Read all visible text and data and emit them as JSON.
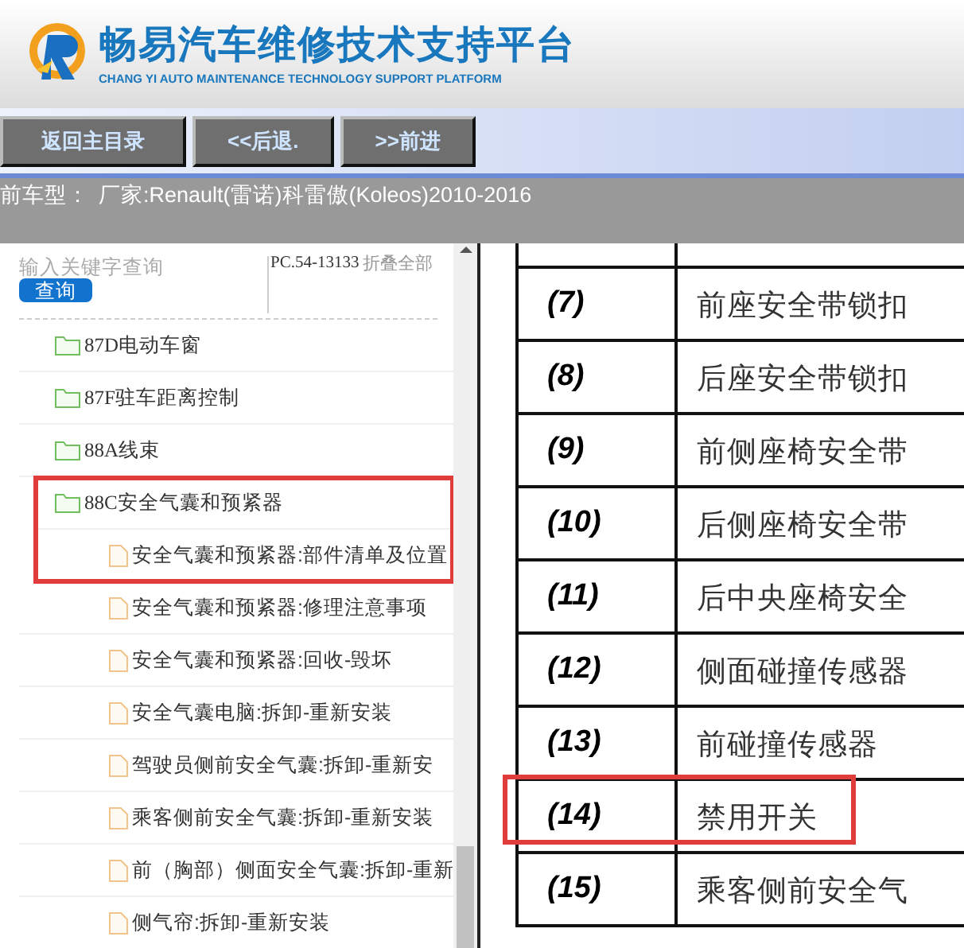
{
  "header": {
    "title": "畅易汽车维修技术支持平台",
    "subtitle": "CHANG YI AUTO MAINTENANCE TECHNOLOGY SUPPORT PLATFORM"
  },
  "nav_buttons": [
    "返回主目录",
    "<<后退.",
    ">>前进"
  ],
  "status_bar": {
    "label": "前车型：",
    "vehicle": "厂家:Renault(雷诺)科雷傲(Koleos)2010-2016"
  },
  "sidebar": {
    "search": {
      "placeholder": "输入关键字查询",
      "button": "查询"
    },
    "code": "PC.54-13133",
    "collapse_all": "折叠全部",
    "items": [
      {
        "kind": "folder",
        "label": "87D电动车窗",
        "highlighted": false
      },
      {
        "kind": "folder",
        "label": "87F驻车距离控制",
        "highlighted": false
      },
      {
        "kind": "folder",
        "label": "88A线束",
        "highlighted": false
      },
      {
        "kind": "folder",
        "label": "88C安全气囊和预紧器",
        "highlighted": true,
        "children": [
          {
            "kind": "page",
            "label": "安全气囊和预紧器:部件清单及位置",
            "highlighted": true
          },
          {
            "kind": "page",
            "label": "安全气囊和预紧器:修理注意事项",
            "highlighted": false
          },
          {
            "kind": "page",
            "label": "安全气囊和预紧器:回收-毁坏",
            "highlighted": false
          },
          {
            "kind": "page",
            "label": "安全气囊电脑:拆卸-重新安装",
            "highlighted": false
          },
          {
            "kind": "page",
            "label": "驾驶员侧前安全气囊:拆卸-重新安",
            "highlighted": false
          },
          {
            "kind": "page",
            "label": "乘客侧前安全气囊:拆卸-重新安装",
            "highlighted": false
          },
          {
            "kind": "page",
            "label": "前（胸部）侧面安全气囊:拆卸-重新",
            "highlighted": false
          },
          {
            "kind": "page",
            "label": "侧气帘:拆卸-重新安装",
            "highlighted": false
          }
        ]
      }
    ]
  },
  "document_table": {
    "rows": [
      {
        "number": "(7)",
        "name": "前座安全带锁扣",
        "highlighted": false
      },
      {
        "number": "(8)",
        "name": "后座安全带锁扣",
        "highlighted": false
      },
      {
        "number": "(9)",
        "name": "前侧座椅安全带",
        "highlighted": false
      },
      {
        "number": "(10)",
        "name": "后侧座椅安全带",
        "highlighted": false
      },
      {
        "number": "(11)",
        "name": "后中央座椅安全",
        "highlighted": false
      },
      {
        "number": "(12)",
        "name": "侧面碰撞传感器",
        "highlighted": false
      },
      {
        "number": "(13)",
        "name": "前碰撞传感器",
        "highlighted": false
      },
      {
        "number": "(14)",
        "name": "禁用开关",
        "highlighted": true
      },
      {
        "number": "(15)",
        "name": "乘客侧前安全气",
        "highlighted": false
      }
    ]
  }
}
